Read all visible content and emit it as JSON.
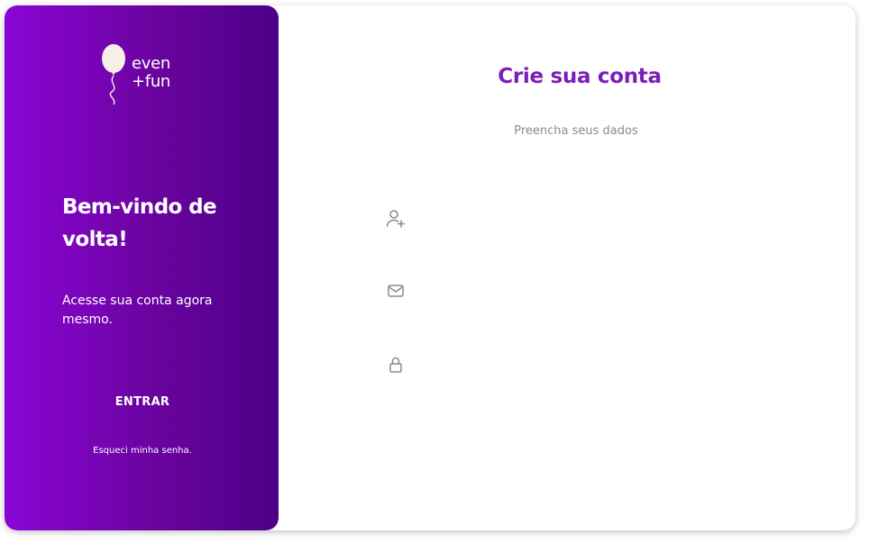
{
  "brand": {
    "logo_line1": "even",
    "logo_line2": "+fun"
  },
  "left_panel": {
    "title": "Bem-vindo de volta!",
    "subtitle": "Acesse sua conta agora mesmo.",
    "enter_button": "ENTRAR",
    "forgot_link": "Esqueci minha senha."
  },
  "right_panel": {
    "title": "Crie sua conta",
    "subtitle": "Preencha seus dados",
    "fields": {
      "name": {
        "icon": "user-plus-icon",
        "value": "",
        "placeholder": ""
      },
      "email": {
        "icon": "mail-icon",
        "value": "",
        "placeholder": ""
      },
      "password": {
        "icon": "lock-icon",
        "value": "",
        "placeholder": ""
      }
    }
  },
  "colors": {
    "gradient_start": "#8a05d6",
    "gradient_end": "#4b0086",
    "title_purple": "#7b1fb8",
    "icon_gray": "#8a8a8a"
  }
}
